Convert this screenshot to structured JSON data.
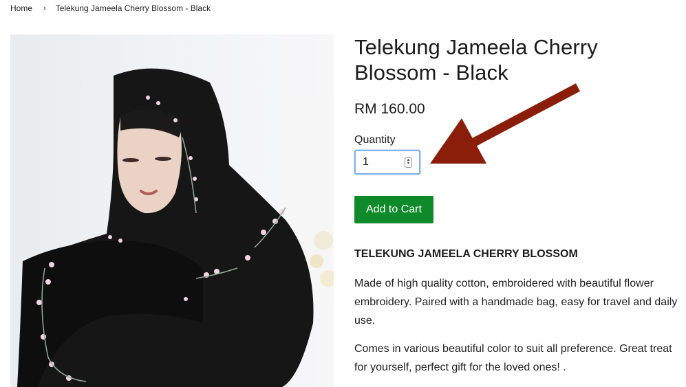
{
  "breadcrumb": {
    "home": "Home",
    "separator": "›",
    "current": "Telekung Jameela Cherry Blossom - Black"
  },
  "product": {
    "title": "Telekung Jameela Cherry Blossom - Black",
    "price": "RM 160.00",
    "quantity_label": "Quantity",
    "quantity_value": "1",
    "add_to_cart": "Add to Cart",
    "description_heading": "TELEKUNG JAMEELA CHERRY BLOSSOM",
    "description": [
      "Made of high quality cotton, embroidered with beautiful flower embroidery. Paired with a handmade bag, easy for travel and daily use.",
      "Comes in various beautiful color to suit all preference. Great treat for yourself, perfect gift for the loved ones! ."
    ]
  },
  "icons": {
    "stepper": "up-down-stepper-icon",
    "annotation": "red-arrow-annotation"
  },
  "colors": {
    "add_to_cart_bg": "#0f8a2a",
    "focus_ring": "#7fb4ee",
    "annotation_arrow": "#8b1e0a"
  }
}
